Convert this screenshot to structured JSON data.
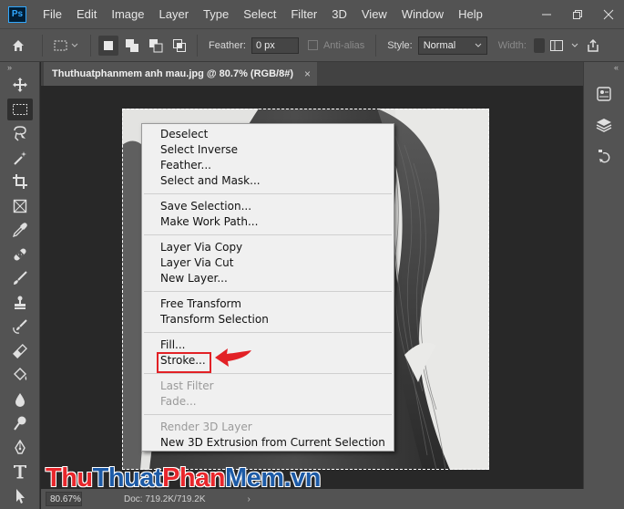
{
  "app": {
    "logo_text": "Ps",
    "menus": [
      "File",
      "Edit",
      "Image",
      "Layer",
      "Type",
      "Select",
      "Filter",
      "3D",
      "View",
      "Window",
      "Help"
    ]
  },
  "options": {
    "feather_label": "Feather:",
    "feather_value": "0 px",
    "anti_alias_label": "Anti-alias",
    "style_label": "Style:",
    "style_value": "Normal",
    "width_label": "Width:"
  },
  "document": {
    "tab_title": "Thuthuatphanmem anh mau.jpg @ 80.7% (RGB/8#)",
    "close_glyph": "×"
  },
  "status": {
    "zoom": "80.67%",
    "doc_size": "Doc: 719.2K/719.2K",
    "arrow": "›"
  },
  "context_menu": {
    "items": {
      "deselect": "Deselect",
      "select_inverse": "Select Inverse",
      "feather": "Feather...",
      "select_and_mask": "Select and Mask...",
      "save_selection": "Save Selection...",
      "make_work_path": "Make Work Path...",
      "layer_via_copy": "Layer Via Copy",
      "layer_via_cut": "Layer Via Cut",
      "new_layer": "New Layer...",
      "free_transform": "Free Transform",
      "transform_selection": "Transform Selection",
      "fill": "Fill...",
      "stroke": "Stroke...",
      "last_filter": "Last Filter",
      "fade": "Fade...",
      "render_3d_layer": "Render 3D Layer",
      "new_3d_extrusion": "New 3D Extrusion from Current Selection"
    },
    "highlight_color": "#e22126"
  },
  "watermark": {
    "part1": "Thu",
    "part2": "Thuat",
    "part3": "Phan",
    "part4": "Mem",
    "part5": ".vn"
  }
}
